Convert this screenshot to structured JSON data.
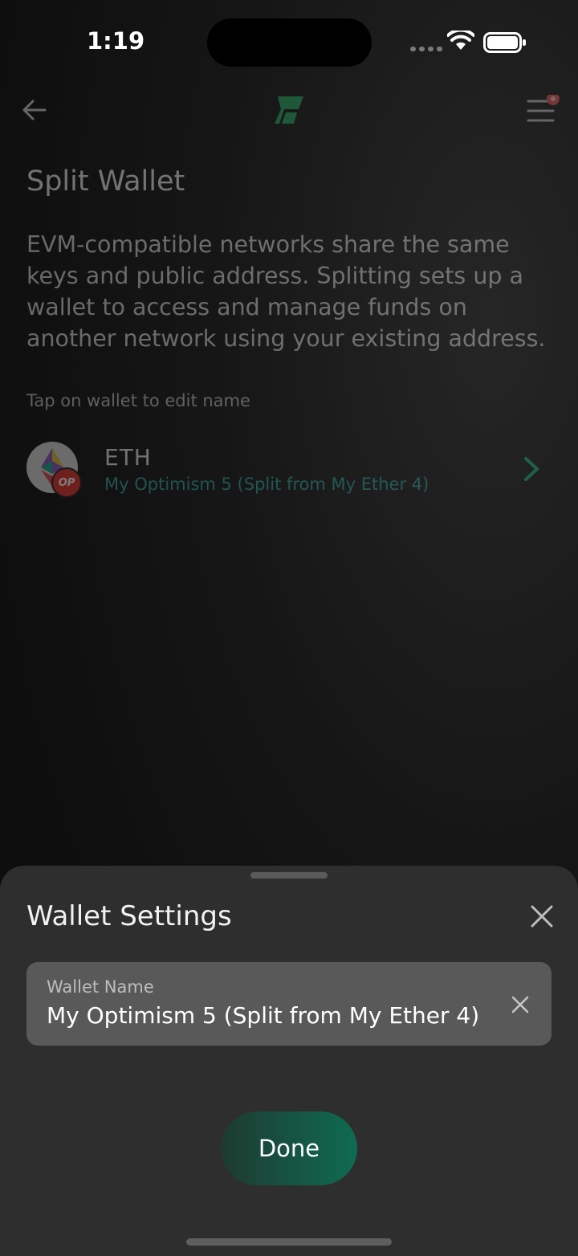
{
  "status_bar": {
    "time": "1:19"
  },
  "header": {
    "back_icon": "arrow-left-icon",
    "logo_icon": "app-logo-icon",
    "menu_icon": "hamburger-menu-icon"
  },
  "page": {
    "title": "Split Wallet",
    "description": "EVM-compatible networks share the same keys and public address. Splitting sets up a wallet to access and manage funds on another network using your existing address.",
    "hint": "Tap on wallet to edit name"
  },
  "wallet": {
    "symbol": "ETH",
    "subtitle": "My Optimism 5 (Split from My Ether 4)",
    "badge": "OP"
  },
  "sheet": {
    "title": "Wallet Settings",
    "field_label": "Wallet Name",
    "field_value": "My Optimism 5 (Split from My Ether 4)",
    "done_label": "Done"
  },
  "colors": {
    "accent": "#0f6b52",
    "link": "#2f9f9a",
    "sheet_bg": "#2e2e2e"
  }
}
